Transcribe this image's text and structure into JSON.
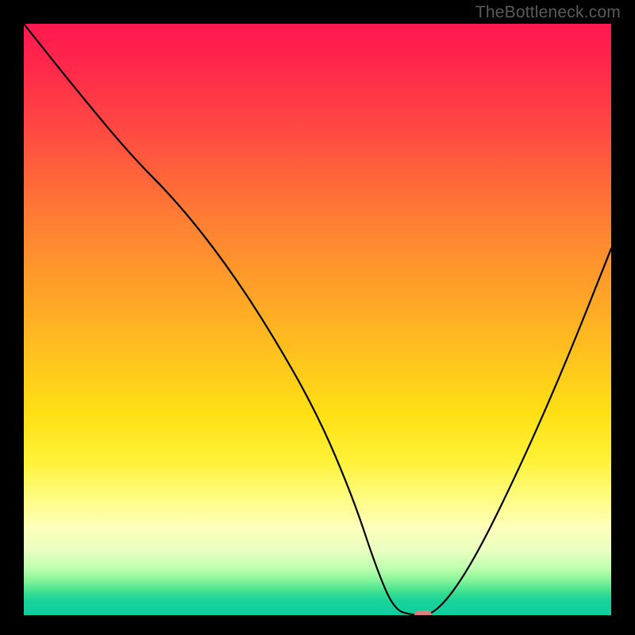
{
  "watermark": "TheBottleneck.com",
  "chart_data": {
    "type": "line",
    "title": "",
    "xlabel": "",
    "ylabel": "",
    "xlim": [
      0,
      100
    ],
    "ylim": [
      0,
      100
    ],
    "grid": false,
    "legend": false,
    "series": [
      {
        "name": "bottleneck-curve",
        "x": [
          0,
          8,
          18,
          26,
          34,
          42,
          50,
          56,
          60,
          63,
          66,
          70,
          76,
          84,
          92,
          100
        ],
        "values": [
          100,
          90,
          78,
          70,
          60,
          48,
          34,
          20,
          8,
          1,
          0,
          0,
          8,
          24,
          42,
          62
        ]
      }
    ],
    "marker": {
      "x": 68,
      "y": 0
    },
    "background_gradient_stops": [
      {
        "pos": 0,
        "color": "#ff1850"
      },
      {
        "pos": 50,
        "color": "#ffc21e"
      },
      {
        "pos": 85,
        "color": "#feffb8"
      },
      {
        "pos": 100,
        "color": "#10cda0"
      }
    ]
  }
}
